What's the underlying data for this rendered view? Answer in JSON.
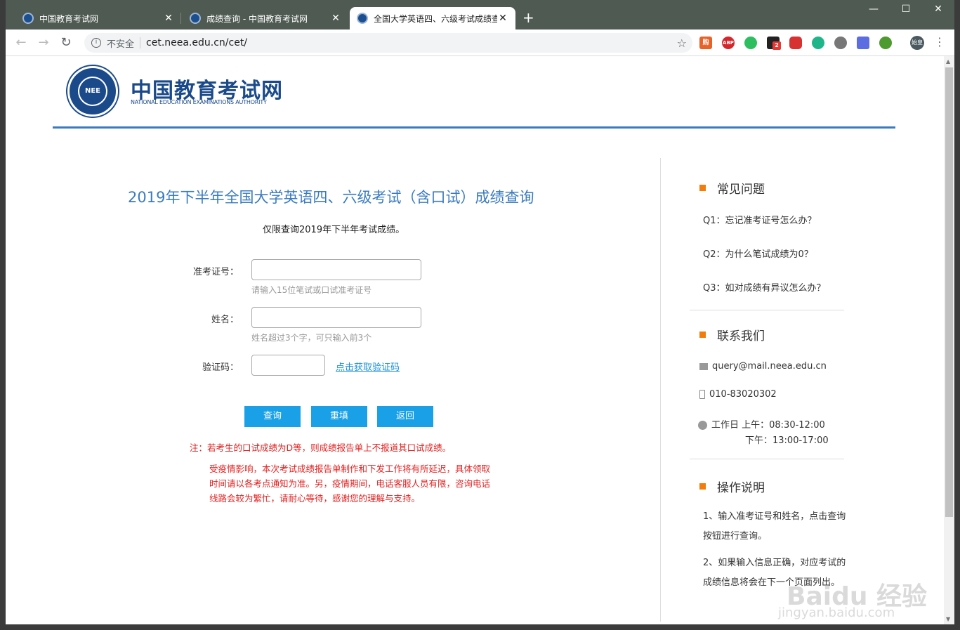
{
  "browser": {
    "tabs": [
      {
        "title": "中国教育考试网"
      },
      {
        "title": "成绩查询 - 中国教育考试网"
      },
      {
        "title": "全国大学英语四、六级考试成绩查"
      }
    ],
    "new_tab": "+",
    "window_controls": {
      "minimize": "—",
      "maximize": "☐",
      "close": "✕"
    },
    "security_label": "不安全",
    "url": "cet.neea.edu.cn/cet/",
    "profile_label": "始皇",
    "extension_badge": "2",
    "extensions": [
      {
        "name": "shopping-extension-icon",
        "color": "#e8632a",
        "label": "购"
      },
      {
        "name": "adblock-extension-icon",
        "color": "#d6262b",
        "label": "ABP"
      },
      {
        "name": "evernote-extension-icon",
        "color": "#2dbe60",
        "label": ""
      },
      {
        "name": "block-extension-icon",
        "color": "#222222",
        "label": ""
      },
      {
        "name": "video-extension-icon",
        "color": "#d83131",
        "label": ""
      },
      {
        "name": "refresh-extension-icon",
        "color": "#1fb58a",
        "label": ""
      },
      {
        "name": "bulb-extension-icon",
        "color": "#777777",
        "label": ""
      },
      {
        "name": "bird-extension-icon",
        "color": "#5b6de0",
        "label": ""
      },
      {
        "name": "globe-extension-icon",
        "color": "#4d9a2f",
        "label": ""
      }
    ]
  },
  "header": {
    "logo_cn": "中国教育考试网",
    "logo_en": "NATIONAL EDUCATION EXAMINATIONS AUTHORITY",
    "logo_mark": "NEE"
  },
  "main": {
    "title": "2019年下半年全国大学英语四、六级考试（含口试）成绩查询",
    "subtitle": "仅限查询2019年下半年考试成绩。",
    "form": {
      "exam_id_label": "准考证号：",
      "exam_id_value": "",
      "exam_id_hint": "请输入15位笔试或口试准考证号",
      "name_label": "姓名：",
      "name_value": "",
      "name_hint": "姓名超过3个字，可只输入前3个",
      "captcha_label": "验证码：",
      "captcha_value": "",
      "captcha_link": "点击获取验证码"
    },
    "buttons": {
      "query": "查询",
      "reset": "重填",
      "back": "返回"
    },
    "note1": "注：若考生的口试成绩为D等，则成绩报告单上不报道其口试成绩。",
    "note2_lines": [
      "受疫情影响，本次考试成绩报告单制作和下发工作将有所延迟，具体领取",
      "时间请以各考点通知为准。另，疫情期间，电话客服人员有限，咨询电话",
      "线路会较为繁忙，请耐心等待，感谢您的理解与支持。"
    ]
  },
  "sidebar": {
    "faq_title": "常见问题",
    "faq": [
      "Q1：忘记准考证号怎么办？",
      "Q2：为什么笔试成绩为0？",
      "Q3：如对成绩有异议怎么办？"
    ],
    "contact_title": "联系我们",
    "email": "query@mail.neea.edu.cn",
    "phone": "010-83020302",
    "hours_am": "工作日 上午：08:30-12:00",
    "hours_pm": "下午：13:00-17:00",
    "ops_title": "操作说明",
    "ops": [
      "1、输入准考证号和姓名，点击查询按钮进行查询。",
      "2、如果输入信息正确，对应考试的成绩信息将会在下一个页面列出。"
    ]
  },
  "watermark": {
    "main": "Baidu 经验",
    "sub": "jingyan.baidu.com"
  }
}
